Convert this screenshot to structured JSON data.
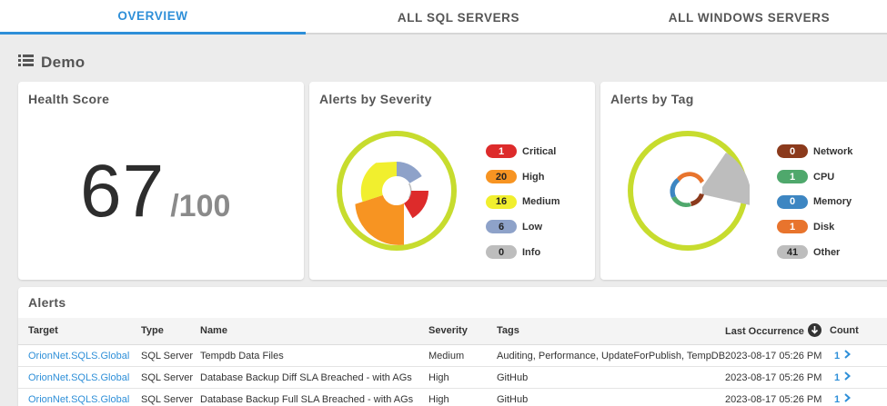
{
  "tabs": [
    {
      "label": "OVERVIEW",
      "active": true
    },
    {
      "label": "ALL SQL SERVERS",
      "active": false
    },
    {
      "label": "ALL WINDOWS SERVERS",
      "active": false
    }
  ],
  "section": {
    "title": "Demo",
    "icon": "list-icon"
  },
  "health": {
    "title": "Health Score",
    "score": "67",
    "max": "/100"
  },
  "severity": {
    "title": "Alerts by Severity",
    "items": [
      {
        "label": "Critical",
        "count": "1",
        "color": "#dd2b2b",
        "text_color": "#ffffff"
      },
      {
        "label": "High",
        "count": "20",
        "color": "#f79422",
        "text_color": "#222222"
      },
      {
        "label": "Medium",
        "count": "16",
        "color": "#f1ef2e",
        "text_color": "#222222"
      },
      {
        "label": "Low",
        "count": "6",
        "color": "#8ea2c9",
        "text_color": "#222222"
      },
      {
        "label": "Info",
        "count": "0",
        "color": "#bdbdbd",
        "text_color": "#222222"
      }
    ]
  },
  "tags": {
    "title": "Alerts by Tag",
    "items": [
      {
        "label": "Network",
        "count": "0",
        "color": "#8b3a1c",
        "text_color": "#ffffff"
      },
      {
        "label": "CPU",
        "count": "1",
        "color": "#4fa86c",
        "text_color": "#ffffff"
      },
      {
        "label": "Memory",
        "count": "0",
        "color": "#3d86c2",
        "text_color": "#ffffff"
      },
      {
        "label": "Disk",
        "count": "1",
        "color": "#e8742d",
        "text_color": "#ffffff"
      },
      {
        "label": "Other",
        "count": "41",
        "color": "#bdbdbd",
        "text_color": "#222222"
      }
    ]
  },
  "alerts": {
    "title": "Alerts",
    "columns": {
      "target": "Target",
      "type": "Type",
      "name": "Name",
      "severity": "Severity",
      "tags": "Tags",
      "last": "Last Occurrence",
      "count": "Count"
    },
    "rows": [
      {
        "target": "OrionNet.SQLS.Global",
        "type": "SQL Server",
        "name": "Tempdb Data Files",
        "severity": "Medium",
        "tags": "Auditing, Performance, UpdateForPublish, TempDB",
        "last": "2023-08-17 05:26 PM",
        "count": "1"
      },
      {
        "target": "OrionNet.SQLS.Global",
        "type": "SQL Server",
        "name": "Database Backup Diff SLA Breached - with AGs",
        "severity": "High",
        "tags": "GitHub",
        "last": "2023-08-17 05:26 PM",
        "count": "1"
      },
      {
        "target": "OrionNet.SQLS.Global",
        "type": "SQL Server",
        "name": "Database Backup Full SLA Breached - with AGs",
        "severity": "High",
        "tags": "GitHub",
        "last": "2023-08-17 05:26 PM",
        "count": "1"
      }
    ]
  },
  "colors": {
    "accent": "#2e8fd8",
    "ring": "#c7dc2e"
  }
}
